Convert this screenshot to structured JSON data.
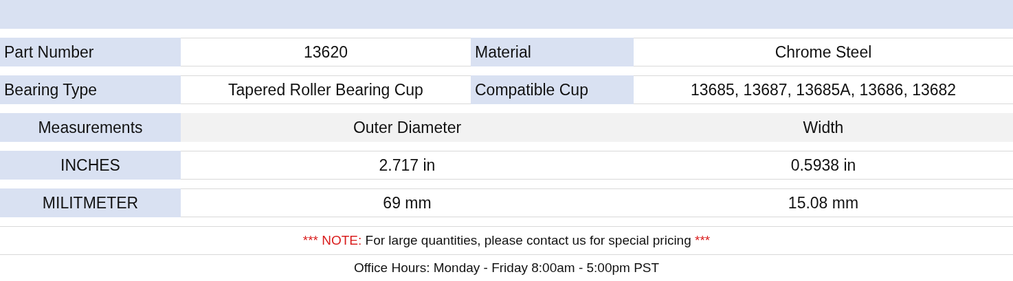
{
  "spec_rows": [
    [
      {
        "label": "Part Number",
        "value": "13620"
      },
      {
        "label": "Material",
        "value": "Chrome Steel"
      }
    ],
    [
      {
        "label": "Bearing Type",
        "value": "Tapered Roller Bearing Cup"
      },
      {
        "label": "Compatible Cup",
        "value": "13685, 13687, 13685A, 13686, 13682"
      }
    ]
  ],
  "measurements": {
    "columns": [
      "Measurements",
      "Outer Diameter",
      "Width"
    ],
    "rows": [
      [
        "INCHES",
        "2.717 in",
        "0.5938 in"
      ],
      [
        "MILITMETER",
        "69 mm",
        "15.08 mm"
      ]
    ]
  },
  "note": {
    "lead": "*** NOTE:",
    "text": "For large quantities, please contact us for special pricing",
    "tail": "***"
  },
  "office_hours": "Office Hours: Monday - Friday 8:00am - 5:00pm PST"
}
